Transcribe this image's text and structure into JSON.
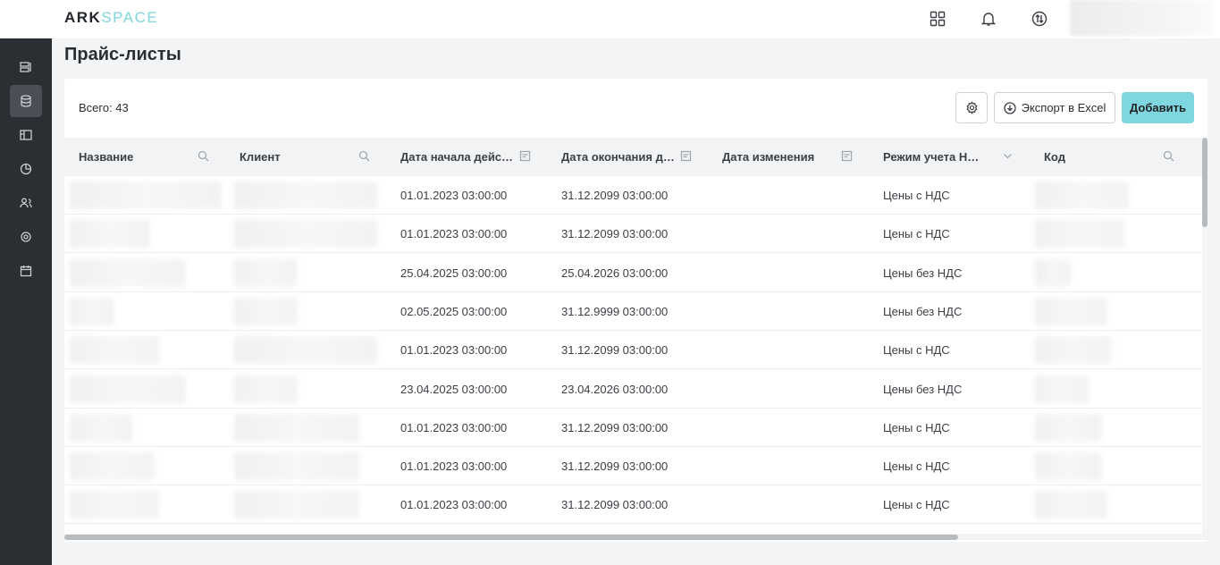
{
  "brand": {
    "ark": "ARK",
    "space": "SPACE"
  },
  "sidebar": {
    "items": [
      {
        "icon": "devices-icon"
      },
      {
        "icon": "database-icon",
        "active": true
      },
      {
        "icon": "layout-icon"
      },
      {
        "icon": "chart-pie-icon"
      },
      {
        "icon": "users-icon"
      },
      {
        "icon": "gear-icon"
      },
      {
        "icon": "calendar-icon"
      }
    ]
  },
  "header": {
    "icons": [
      "apps-grid-icon",
      "bell-icon",
      "swap-icon"
    ]
  },
  "page": {
    "title": "Прайс-листы",
    "total": "Всего: 43",
    "export_label": "Экспорт в Excel",
    "add_label": "Добавить"
  },
  "table": {
    "columns": [
      {
        "label": "Название",
        "icon": "search-icon"
      },
      {
        "label": "Клиент",
        "icon": "search-icon"
      },
      {
        "label": "Дата начала действ…",
        "icon": "filter-calendar-icon"
      },
      {
        "label": "Дата окончания дей…",
        "icon": "filter-calendar-icon"
      },
      {
        "label": "Дата изменения",
        "icon": "filter-calendar-icon"
      },
      {
        "label": "Режим учета Н…",
        "icon": "chevron-down-icon"
      },
      {
        "label": "Код",
        "icon": "search-icon"
      }
    ],
    "rows": [
      {
        "start": "01.01.2023 03:00:00",
        "end": "31.12.2099 03:00:00",
        "changed": "",
        "mode": "Цены с НДС"
      },
      {
        "start": "01.01.2023 03:00:00",
        "end": "31.12.2099 03:00:00",
        "changed": "",
        "mode": "Цены с НДС"
      },
      {
        "start": "25.04.2025 03:00:00",
        "end": "25.04.2026 03:00:00",
        "changed": "",
        "mode": "Цены без НДС"
      },
      {
        "start": "02.05.2025 03:00:00",
        "end": "31.12.9999 03:00:00",
        "changed": "",
        "mode": "Цены без НДС"
      },
      {
        "start": "01.01.2023 03:00:00",
        "end": "31.12.2099 03:00:00",
        "changed": "",
        "mode": "Цены с НДС"
      },
      {
        "start": "23.04.2025 03:00:00",
        "end": "23.04.2026 03:00:00",
        "changed": "",
        "mode": "Цены без НДС"
      },
      {
        "start": "01.01.2023 03:00:00",
        "end": "31.12.2099 03:00:00",
        "changed": "",
        "mode": "Цены с НДС"
      },
      {
        "start": "01.01.2023 03:00:00",
        "end": "31.12.2099 03:00:00",
        "changed": "",
        "mode": "Цены с НДС"
      },
      {
        "start": "01.01.2023 03:00:00",
        "end": "31.12.2099 03:00:00",
        "changed": "",
        "mode": "Цены с НДС"
      }
    ]
  },
  "colors": {
    "accent": "#7fd6de",
    "sidebar": "#2b2e33"
  }
}
